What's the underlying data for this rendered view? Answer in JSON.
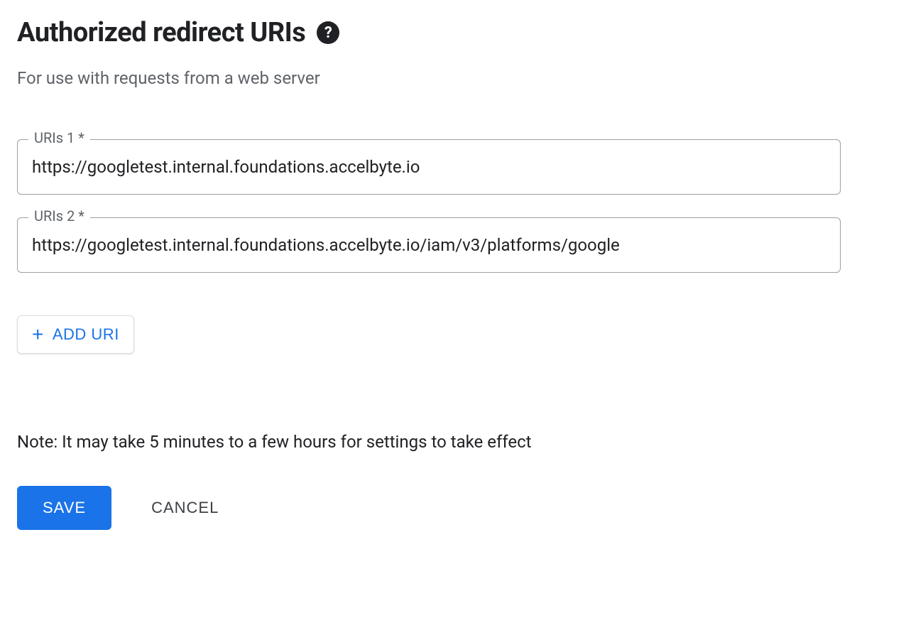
{
  "header": {
    "title": "Authorized redirect URIs"
  },
  "description": "For use with requests from a web server",
  "uris": [
    {
      "label": "URIs 1 *",
      "value": "https://googletest.internal.foundations.accelbyte.io"
    },
    {
      "label": "URIs 2 *",
      "value": "https://googletest.internal.foundations.accelbyte.io/iam/v3/platforms/google"
    }
  ],
  "add_uri_label": "ADD URI",
  "note": "Note: It may take 5 minutes to a few hours for settings to take effect",
  "buttons": {
    "save": "SAVE",
    "cancel": "CANCEL"
  },
  "colors": {
    "primary": "#1a73e8",
    "text": "#202124",
    "muted": "#5f6368",
    "border": "#9aa0a6"
  }
}
